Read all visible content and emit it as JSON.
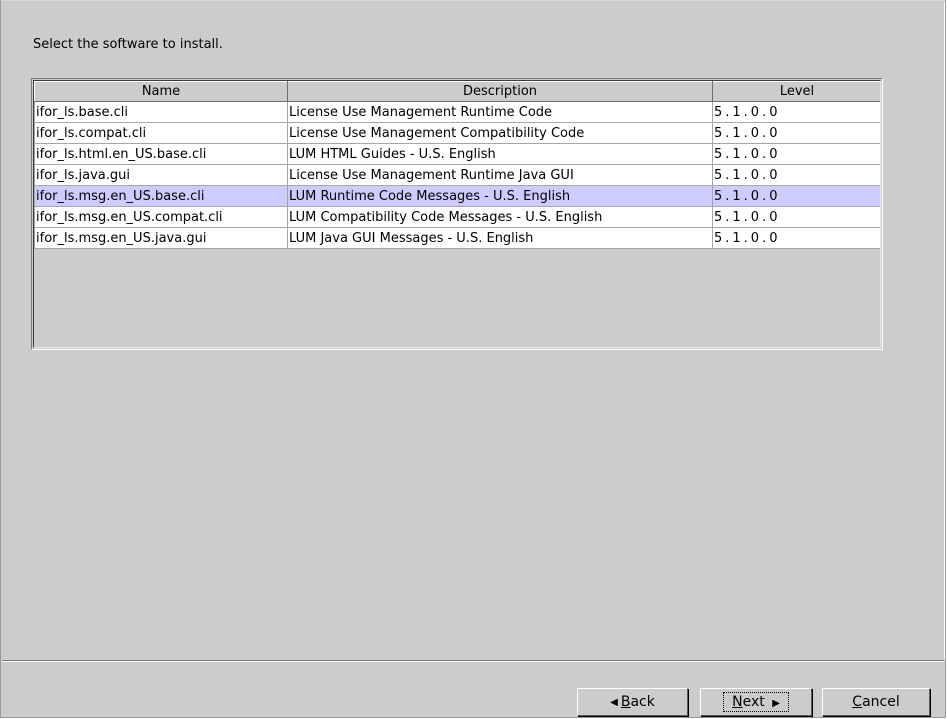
{
  "instruction": "Select the software to install.",
  "table": {
    "columns": [
      "Name",
      "Description",
      "Level"
    ],
    "selected_row": 4,
    "rows": [
      {
        "name": "ifor_ls.base.cli",
        "description": "License Use Management Runtime Code",
        "level": "5.1.0.0"
      },
      {
        "name": "ifor_ls.compat.cli",
        "description": "License Use Management Compatibility Code",
        "level": "5.1.0.0"
      },
      {
        "name": "ifor_ls.html.en_US.base.cli",
        "description": "LUM HTML Guides - U.S. English",
        "level": "5.1.0.0"
      },
      {
        "name": "ifor_ls.java.gui",
        "description": "License Use Management Runtime Java GUI",
        "level": "5.1.0.0"
      },
      {
        "name": "ifor_ls.msg.en_US.base.cli",
        "description": "LUM Runtime Code Messages - U.S. English",
        "level": "5.1.0.0"
      },
      {
        "name": "ifor_ls.msg.en_US.compat.cli",
        "description": "LUM Compatibility Code Messages - U.S. English",
        "level": "5.1.0.0"
      },
      {
        "name": "ifor_ls.msg.en_US.java.gui",
        "description": "LUM Java GUI Messages - U.S. English",
        "level": "5.1.0.0"
      }
    ]
  },
  "buttons": {
    "back": {
      "mnemonic": "B",
      "rest": "ack",
      "icon": "triangle-left-icon"
    },
    "next": {
      "mnemonic": "N",
      "rest": "ext",
      "icon": "triangle-right-icon"
    },
    "cancel": {
      "mnemonic": "C",
      "rest": "ancel"
    }
  },
  "colors": {
    "selection": "#ccccff",
    "panel": "#cccccc"
  }
}
